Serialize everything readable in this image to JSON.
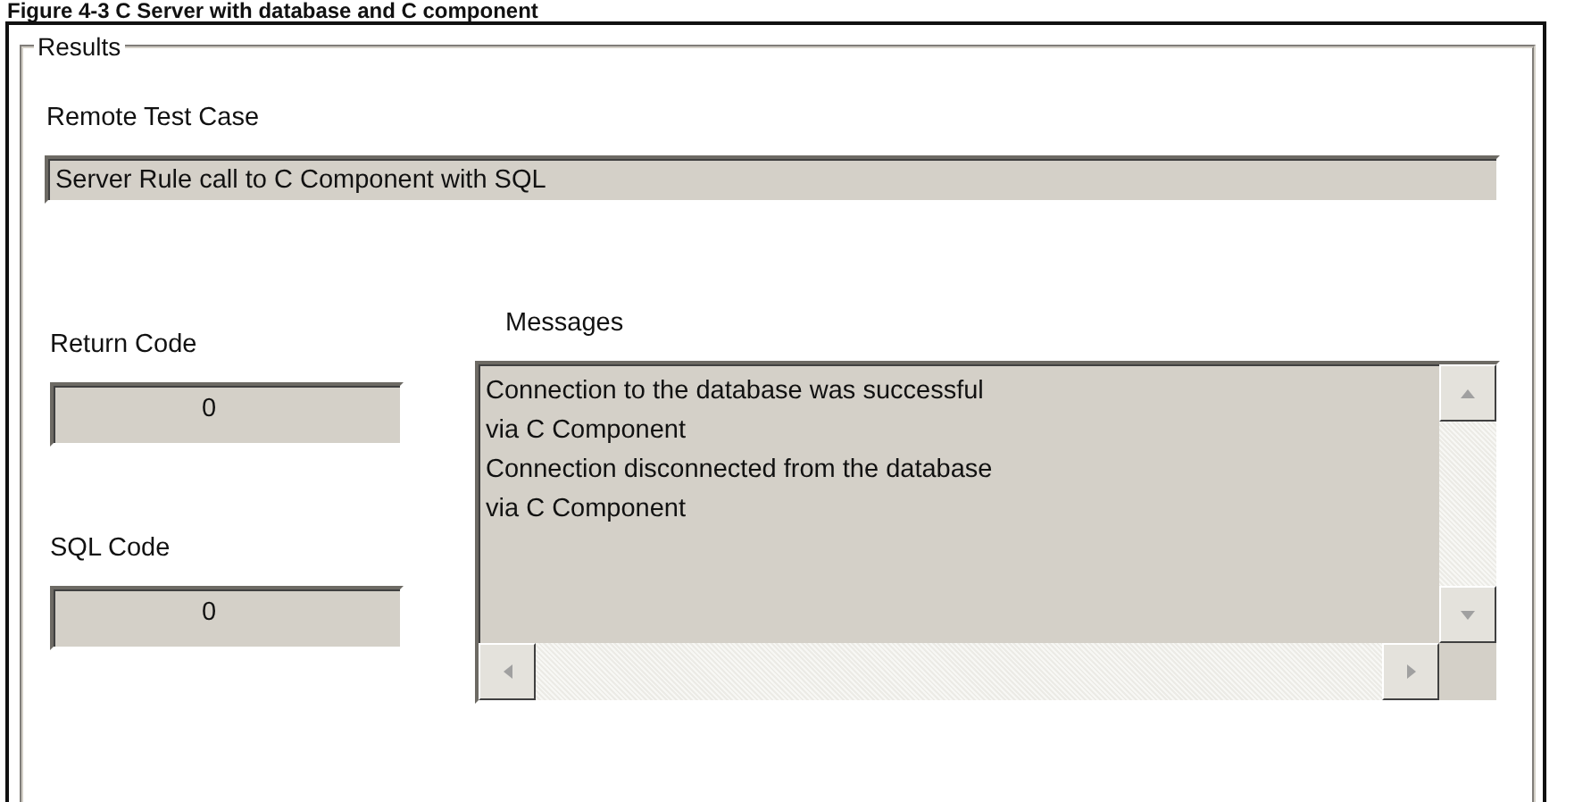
{
  "caption": "Figure 4-3 C Server with database and C component",
  "group": {
    "title": "Results"
  },
  "remote_test_case": {
    "label": "Remote Test Case",
    "value": "Server Rule call to C Component with SQL"
  },
  "return_code": {
    "label": "Return Code",
    "value": "0"
  },
  "sql_code": {
    "label": "SQL Code",
    "value": "0"
  },
  "messages": {
    "label": "Messages",
    "lines": [
      "Connection to the database was successful",
      "via C Component",
      "Connection disconnected from the database",
      "via C Component"
    ]
  }
}
